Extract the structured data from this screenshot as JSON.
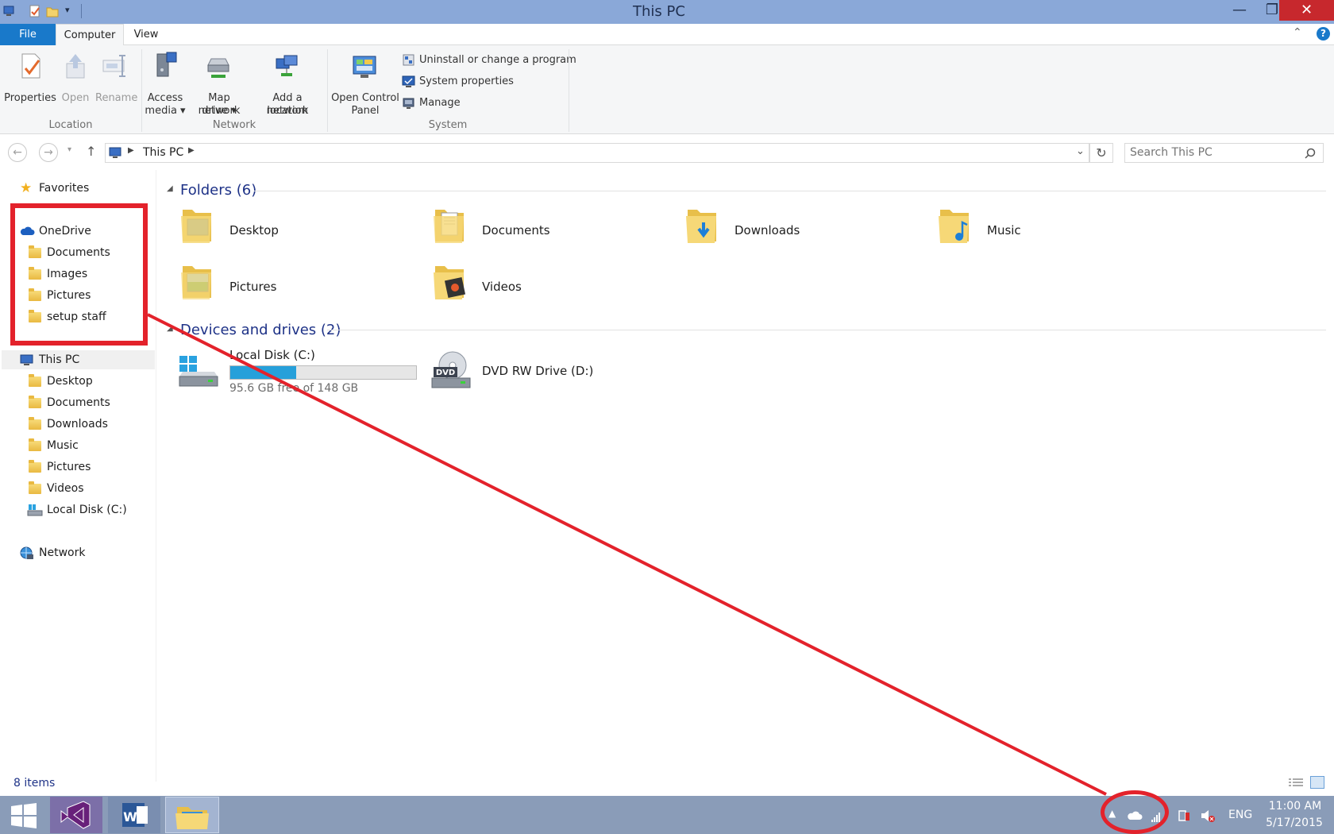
{
  "window": {
    "title": "This PC",
    "minimize": "—",
    "maximize": "❐",
    "close": "✕"
  },
  "ribbon": {
    "tabs": [
      {
        "label": "File"
      },
      {
        "label": "Computer"
      },
      {
        "label": "View"
      }
    ],
    "location": {
      "group_label": "Location",
      "properties": "Properties",
      "open": "Open",
      "rename": "Rename"
    },
    "network": {
      "group_label": "Network",
      "access_media_1": "Access",
      "access_media_2": "media ▾",
      "map_drive_1": "Map network",
      "map_drive_2": "drive ▾",
      "add_location_1": "Add a network",
      "add_location_2": "location"
    },
    "system": {
      "group_label": "System",
      "control_panel_1": "Open Control",
      "control_panel_2": "Panel",
      "uninstall": "Uninstall or change a program",
      "system_properties": "System properties",
      "manage": "Manage"
    }
  },
  "address": {
    "path": "This PC",
    "search_placeholder": "Search This PC"
  },
  "nav": {
    "favorites": "Favorites",
    "onedrive": "OneDrive",
    "onedrive_items": [
      "Documents",
      "Images",
      "Pictures",
      "setup staff"
    ],
    "this_pc": "This PC",
    "this_pc_items": [
      "Desktop",
      "Documents",
      "Downloads",
      "Music",
      "Pictures",
      "Videos",
      "Local Disk (C:)"
    ],
    "network": "Network"
  },
  "content": {
    "folders_header": "Folders (6)",
    "folders": [
      "Desktop",
      "Documents",
      "Downloads",
      "Music",
      "Pictures",
      "Videos"
    ],
    "drives_header": "Devices and drives (2)",
    "local_disk": {
      "name": "Local Disk (C:)",
      "free_text": "95.6 GB free of 148 GB",
      "used_fraction": 0.354
    },
    "dvd": {
      "name": "DVD RW Drive (D:)",
      "badge": "DVD"
    }
  },
  "status": {
    "items": "8 items"
  },
  "taskbar": {
    "language": "ENG",
    "time": "11:00 AM",
    "date": "5/17/2015"
  },
  "colors": {
    "title_bar": "#8aa8d8",
    "file_tab": "#1979ca",
    "close_button": "#c7282d",
    "annotation": "#e3222b",
    "disk_bar": "#26a0da",
    "taskbar": "#8a9cb8"
  }
}
